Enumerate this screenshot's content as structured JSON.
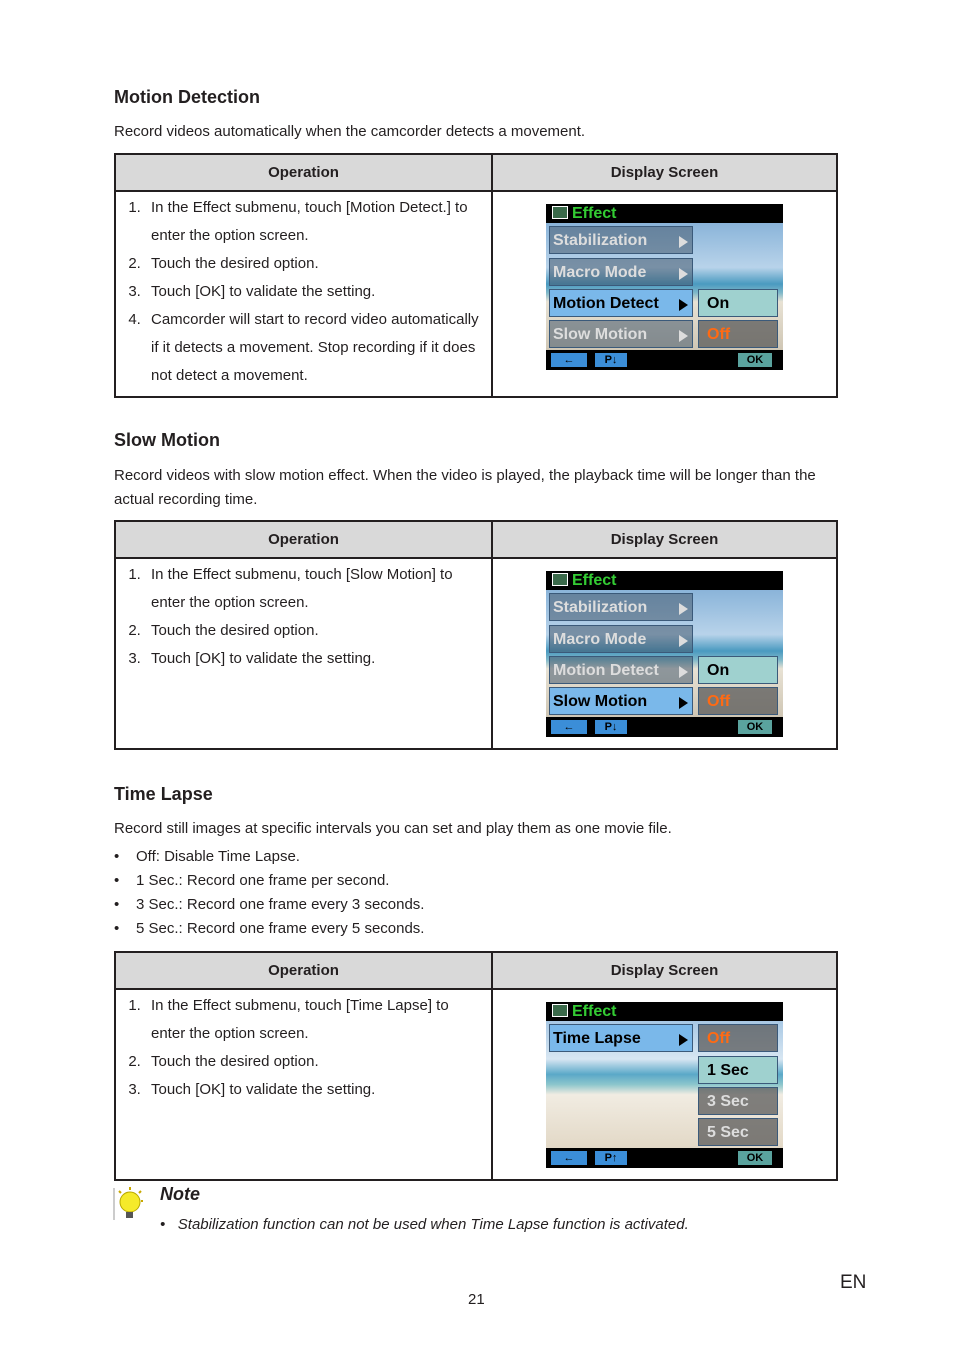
{
  "sections": [
    {
      "title": "Motion Detection",
      "description": "Record videos automatically when the camcorder detects a movement.",
      "table": {
        "headers": [
          "Operation",
          "Display Screen"
        ],
        "steps": [
          "In the Effect submenu, touch [Motion Detect.] to enter the option screen.",
          "Touch the desired option.",
          "Touch [OK] to validate the setting.",
          "Camcorder will start to record video automatically if it detects a movement. Stop recording if it does not detect a movement."
        ]
      },
      "screen": {
        "title": "Effect",
        "menu_items": [
          "Stabilization",
          "Macro Mode",
          "Motion Detect",
          "Slow Motion"
        ],
        "selected_item": "Motion Detect",
        "options": [
          "On",
          "Off"
        ],
        "highlighted_option": "On",
        "current_value": "Off",
        "buttons": {
          "back": "←",
          "page": "P↓",
          "ok": "OK"
        }
      }
    },
    {
      "title": "Slow Motion",
      "description": "Record videos with slow motion effect. When the video is played, the playback time will be longer than the actual recording time.",
      "table": {
        "headers": [
          "Operation",
          "Display Screen"
        ],
        "steps": [
          "In the Effect submenu, touch [Slow Motion] to enter the option screen.",
          "Touch the desired option.",
          "Touch [OK] to validate the setting."
        ]
      },
      "screen": {
        "title": "Effect",
        "menu_items": [
          "Stabilization",
          "Macro Mode",
          "Motion Detect",
          "Slow Motion"
        ],
        "selected_item": "Slow Motion",
        "options": [
          "On",
          "Off"
        ],
        "highlighted_option": "On",
        "current_value": "Off",
        "buttons": {
          "back": "←",
          "page": "P↓",
          "ok": "OK"
        }
      }
    },
    {
      "title": "Time Lapse",
      "description": "Record still images at specific intervals you can set and play them as one movie file.",
      "bullets": [
        "Off: Disable Time Lapse.",
        "1 Sec.: Record one frame per second.",
        "3 Sec.: Record one frame every 3 seconds.",
        "5 Sec.: Record one frame every 5 seconds."
      ],
      "table": {
        "headers": [
          "Operation",
          "Display Screen"
        ],
        "steps": [
          "In the Effect submenu, touch [Time Lapse] to enter the option screen.",
          "Touch the desired option.",
          "Touch [OK] to validate the setting."
        ]
      },
      "screen": {
        "title": "Effect",
        "menu_items": [
          "Time Lapse"
        ],
        "selected_item": "Time Lapse",
        "options": [
          "Off",
          "1 Sec",
          "3 Sec",
          "5 Sec"
        ],
        "highlighted_option": "1 Sec",
        "current_value": "Off",
        "buttons": {
          "back": "←",
          "page": "P↑",
          "ok": "OK"
        }
      }
    }
  ],
  "note": {
    "title": "Note",
    "text": "Stabilization function can not be used when Time Lapse function is activated."
  },
  "footer": {
    "page_number": "21",
    "language": "EN"
  },
  "colors": {
    "effect_title": "#33cc33",
    "selected_item": "#7ab8ea",
    "highlighted_option": "#9fd1cf",
    "current_value": "#ff6a13"
  }
}
